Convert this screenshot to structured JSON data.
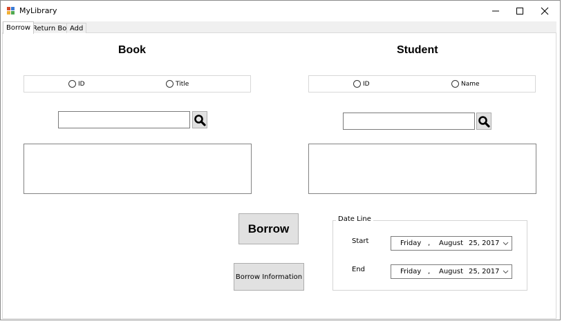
{
  "window": {
    "title": "MyLibrary"
  },
  "tabs": [
    {
      "label": "Borrow"
    },
    {
      "label": "Return Book"
    },
    {
      "label": "Add"
    }
  ],
  "book": {
    "title": "Book",
    "radio_id": "ID",
    "radio_title": "Title",
    "search_value": ""
  },
  "student": {
    "title": "Student",
    "radio_id": "ID",
    "radio_name": "Name",
    "search_value": ""
  },
  "buttons": {
    "borrow": "Borrow",
    "borrow_info": "Borrow Information"
  },
  "dateline": {
    "legend": "Date Line",
    "start_label": "Start",
    "end_label": "End",
    "start": {
      "weekday": "Friday",
      "sep": ",",
      "month": "August",
      "day_year": "25, 2017"
    },
    "end": {
      "weekday": "Friday",
      "sep": ",",
      "month": "August",
      "day_year": "25, 2017"
    }
  },
  "icons": {
    "app": "app-icon",
    "search": "search-icon",
    "dropdown": "chevron-down-icon",
    "minimize": "minimize-icon",
    "maximize": "maximize-icon",
    "close": "close-icon"
  }
}
